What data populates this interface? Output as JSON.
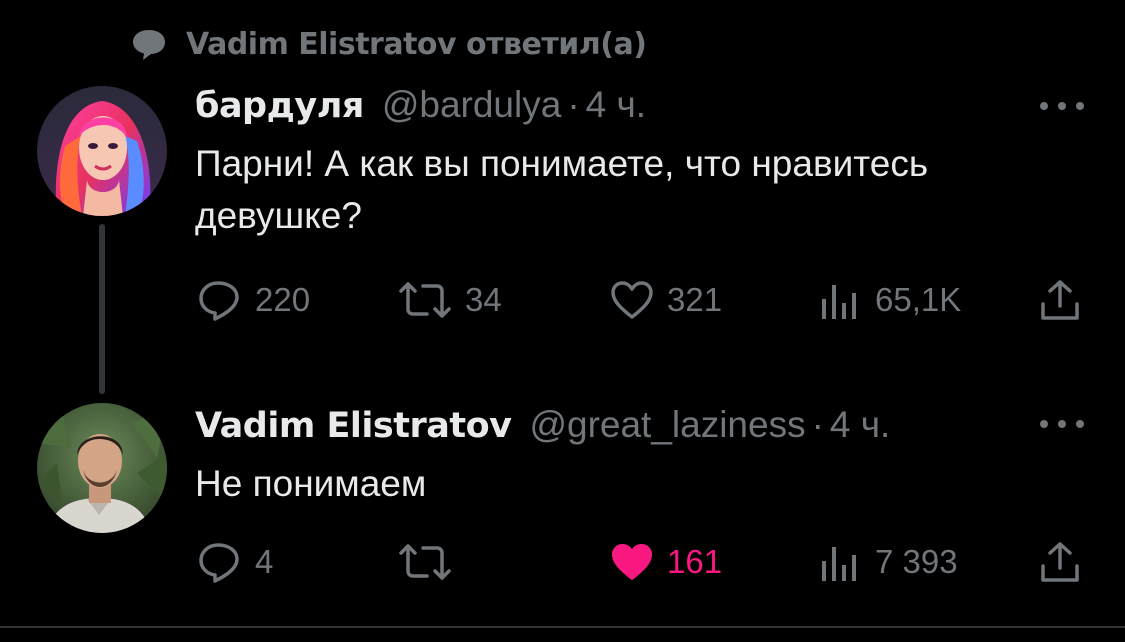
{
  "context": {
    "icon": "speech-bubble-icon",
    "label": "Vadim Elistratov ответил(а)"
  },
  "tweets": [
    {
      "name": "бардуля",
      "handle": "@bardulya",
      "separator": "·",
      "time": "4 ч.",
      "avatar": "illustrated-woman-avatar",
      "text": "Парни! А как вы понимаете, что нравитесь девушке?",
      "replies": "220",
      "retweets": "34",
      "likes": "321",
      "views": "65,1K",
      "liked": false
    },
    {
      "name": "Vadim Elistratov",
      "handle": "@great_laziness",
      "separator": "·",
      "time": "4 ч.",
      "avatar": "man-photo-avatar",
      "text": "Не понимаем",
      "replies": "4",
      "retweets": "",
      "likes": "161",
      "views": "7 393",
      "liked": true
    }
  ],
  "colors": {
    "background": "#000000",
    "primary_text": "#e7e9ea",
    "secondary_text": "#71767b",
    "like_active": "#f91880",
    "thread_line": "#333639"
  }
}
